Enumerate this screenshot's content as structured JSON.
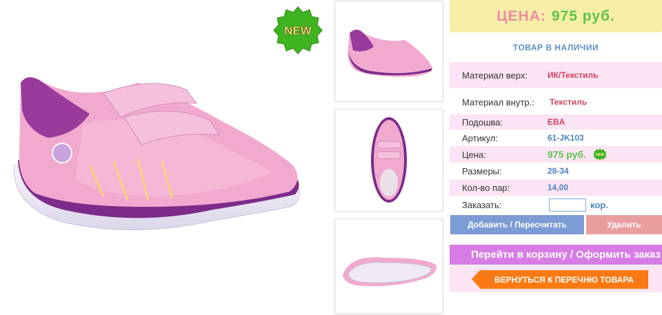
{
  "badge": {
    "new_label": "NEW",
    "mini_new_label": "NEW"
  },
  "gallery": {
    "main_alt": "main-shoe-photo",
    "thumbnails": [
      "thumb-side",
      "thumb-top",
      "thumb-sole"
    ]
  },
  "price_header": {
    "label": "ЦЕНА:",
    "value": "975 руб."
  },
  "stock_text": "ТОВАР В НАЛИЧИИ",
  "specs": [
    {
      "key": "Материал верх:",
      "value": "ИК/Текстиль"
    },
    {
      "key": "Материал внутр.:",
      "value": "Текстиль"
    },
    {
      "key": "Подошва:",
      "value": "EBA"
    },
    {
      "key": "Артикул:",
      "value": "61-JK103"
    },
    {
      "key": "Цена:",
      "value": "975 руб."
    },
    {
      "key": "Размеры:",
      "value": "28-34"
    },
    {
      "key": "Кол-во пар:",
      "value": "14,00"
    }
  ],
  "order": {
    "label": "Заказать:",
    "value": "",
    "unit": "кор."
  },
  "buttons": {
    "add": "Добавить / Пересчитать",
    "delete": "Удалить",
    "cart": "Перейти в корзину / Оформить заказ",
    "back": "ВЕРНУТЬСЯ К ПЕРЕЧНЮ ТОВАРА"
  },
  "colors": {
    "accent_pink": "#fbe4f3",
    "price_green": "#5cc44c",
    "button_blue": "#7d9bd4",
    "button_red": "#ea9d9f",
    "button_purple": "#d77ce4",
    "button_orange": "#f97a14"
  }
}
